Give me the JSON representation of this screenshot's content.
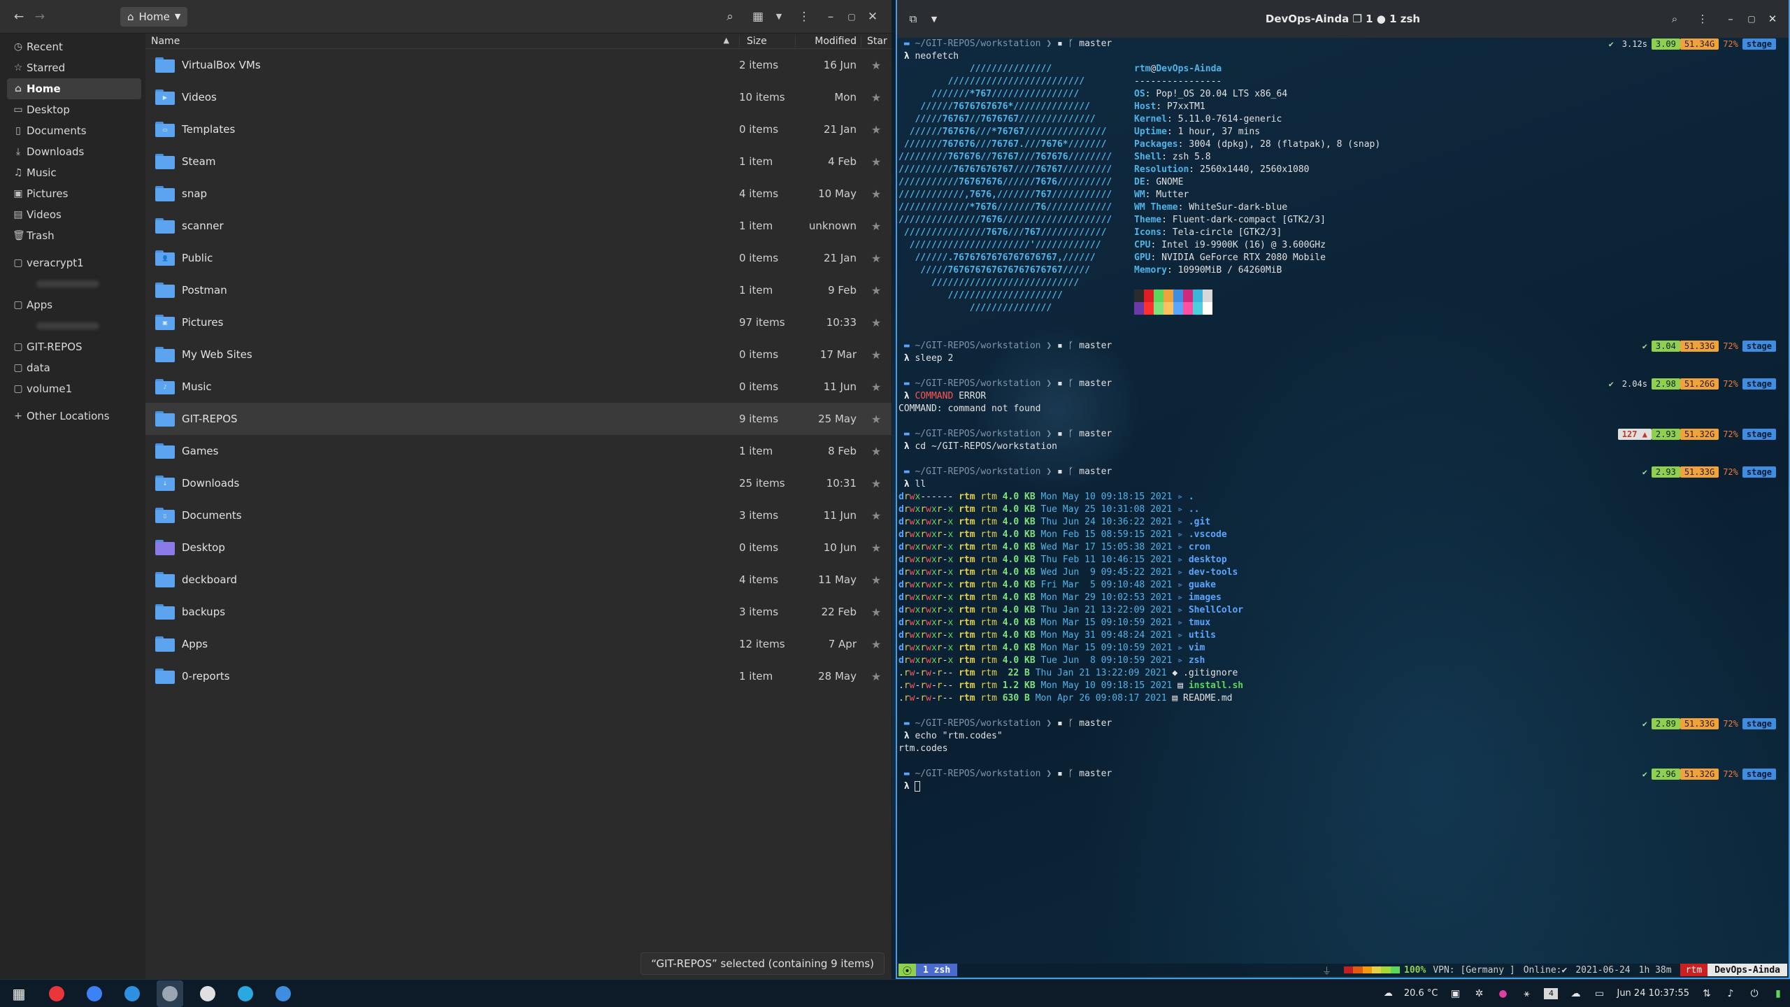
{
  "file_manager": {
    "location": "Home",
    "columns": {
      "name": "Name",
      "size": "Size",
      "modified": "Modified",
      "star": "Star"
    },
    "sidebar": [
      {
        "label": "Recent",
        "icon": "clock-icon",
        "glyph": "◷"
      },
      {
        "label": "Starred",
        "icon": "star-icon",
        "glyph": "☆"
      },
      {
        "label": "Home",
        "icon": "home-icon",
        "glyph": "⌂",
        "active": true
      },
      {
        "label": "Desktop",
        "icon": "desktop-icon",
        "glyph": "▭"
      },
      {
        "label": "Documents",
        "icon": "document-icon",
        "glyph": "▯"
      },
      {
        "label": "Downloads",
        "icon": "download-icon",
        "glyph": "⤓"
      },
      {
        "label": "Music",
        "icon": "music-icon",
        "glyph": "♫"
      },
      {
        "label": "Pictures",
        "icon": "picture-icon",
        "glyph": "▣"
      },
      {
        "label": "Videos",
        "icon": "video-icon",
        "glyph": "▤"
      },
      {
        "label": "Trash",
        "icon": "trash-icon",
        "glyph": "🗑"
      },
      {
        "separator": true
      },
      {
        "label": "veracrypt1",
        "icon": "drive-icon",
        "glyph": "▢"
      },
      {
        "blurred": true
      },
      {
        "label": "Apps",
        "icon": "drive-icon",
        "glyph": "▢"
      },
      {
        "blurred": true
      },
      {
        "label": "GIT-REPOS",
        "icon": "drive-icon",
        "glyph": "▢"
      },
      {
        "label": "data",
        "icon": "drive-icon",
        "glyph": "▢"
      },
      {
        "label": "volume1",
        "icon": "drive-icon",
        "glyph": "▢"
      },
      {
        "separator": true
      },
      {
        "label": "Other Locations",
        "icon": "plus-icon",
        "glyph": "+"
      }
    ],
    "files": [
      {
        "name": "VirtualBox VMs",
        "size": "2 items",
        "modified": "16 Jun"
      },
      {
        "name": "Videos",
        "size": "10 items",
        "modified": "Mon",
        "emblem": "▶"
      },
      {
        "name": "Templates",
        "size": "0 items",
        "modified": "21 Jan",
        "emblem": "▭"
      },
      {
        "name": "Steam",
        "size": "1 item",
        "modified": "4 Feb"
      },
      {
        "name": "snap",
        "size": "4 items",
        "modified": "10 May"
      },
      {
        "name": "scanner",
        "size": "1 item",
        "modified": "unknown"
      },
      {
        "name": "Public",
        "size": "0 items",
        "modified": "21 Jan",
        "emblem": "👤"
      },
      {
        "name": "Postman",
        "size": "1 item",
        "modified": "9 Feb"
      },
      {
        "name": "Pictures",
        "size": "97 items",
        "modified": "10:33",
        "emblem": "▣"
      },
      {
        "name": "My Web Sites",
        "size": "0 items",
        "modified": "17 Mar"
      },
      {
        "name": "Music",
        "size": "0 items",
        "modified": "11 Jun",
        "emblem": "♪"
      },
      {
        "name": "GIT-REPOS",
        "size": "9 items",
        "modified": "25 May",
        "selected": true
      },
      {
        "name": "Games",
        "size": "1 item",
        "modified": "8 Feb"
      },
      {
        "name": "Downloads",
        "size": "25 items",
        "modified": "10:31",
        "emblem": "↓"
      },
      {
        "name": "Documents",
        "size": "3 items",
        "modified": "11 Jun",
        "emblem": "▯"
      },
      {
        "name": "Desktop",
        "size": "0 items",
        "modified": "10 Jun",
        "desktop": true
      },
      {
        "name": "deckboard",
        "size": "4 items",
        "modified": "11 May"
      },
      {
        "name": "backups",
        "size": "3 items",
        "modified": "22 Feb"
      },
      {
        "name": "Apps",
        "size": "12 items",
        "modified": "7 Apr"
      },
      {
        "name": "0-reports",
        "size": "1 item",
        "modified": "28 May"
      }
    ],
    "status": "“GIT-REPOS” selected (containing 9 items)"
  },
  "terminal": {
    "title": "DevOps-Ainda ❐ 1 ● 1 zsh",
    "prompt_path": "~/GIT-REPOS/workstation",
    "branch": "master",
    "neofetch": {
      "command": "neofetch",
      "user": "rtm",
      "host": "DevOps-Ainda",
      "divider": "----------------",
      "info": [
        {
          "k": "OS",
          "v": "Pop!_OS 20.04 LTS x86_64"
        },
        {
          "k": "Host",
          "v": "P7xxTM1"
        },
        {
          "k": "Kernel",
          "v": "5.11.0-7614-generic"
        },
        {
          "k": "Uptime",
          "v": "1 hour, 37 mins"
        },
        {
          "k": "Packages",
          "v": "3004 (dpkg), 28 (flatpak), 8 (snap)"
        },
        {
          "k": "Shell",
          "v": "zsh 5.8"
        },
        {
          "k": "Resolution",
          "v": "2560x1440, 2560x1080"
        },
        {
          "k": "DE",
          "v": "GNOME"
        },
        {
          "k": "WM",
          "v": "Mutter"
        },
        {
          "k": "WM Theme",
          "v": "WhiteSur-dark-blue"
        },
        {
          "k": "Theme",
          "v": "Fluent-dark-compact [GTK2/3]"
        },
        {
          "k": "Icons",
          "v": "Tela-circle [GTK2/3]"
        },
        {
          "k": "CPU",
          "v": "Intel i9-9900K (16) @ 3.600GHz"
        },
        {
          "k": "GPU",
          "v": "NVIDIA GeForce RTX 2080 Mobile"
        },
        {
          "k": "Memory",
          "v": "10990MiB / 64260MiB"
        }
      ],
      "logo": [
        "             ///////////////",
        "         /////////////////////////",
        "      ///////*767////////////////",
        "    //////7676767676*//////////////",
        "   /////76767//7676767//////////////",
        "  //////767676///*76767///////////////",
        " ///////767676///76767.///7676*///////",
        "/////////767676//76767///767676////////",
        "//////////76767676767////76767/////////",
        "///////////76767676//////7676//////////",
        "////////////,7676,///////767///////////",
        "/////////////*7676///////76////////////",
        "///////////////7676////////////////////",
        " ///////////////7676///767////////////",
        "  //////////////////////'////////////",
        "   //////.7676767676767676767,//////",
        "    /////767676767676767676767/////",
        "      ///////////////////////////",
        "         /////////////////////",
        "             ///////////////"
      ],
      "palette": [
        "#2b2b2b",
        "#e01b24",
        "#5bd75b",
        "#f0a33a",
        "#3e8de0",
        "#d0287a",
        "#3cb6d8",
        "#d8d8d8",
        "#6a3aa8",
        "#ff3030",
        "#7ee37e",
        "#ffc060",
        "#5aa6ff",
        "#ff4fa0",
        "#4cd0e0",
        "#ffffff"
      ]
    },
    "blocks": [
      {
        "cmd": "sleep 2",
        "rp": {
          "ok": "✔",
          "load": "3.04",
          "mem": "51.33G",
          "bat": "72%",
          "ctx": "stage"
        }
      },
      {
        "cmd_err": "COMMAND",
        "cmd_rest": " ERROR",
        "output": [
          "COMMAND: command not found"
        ],
        "rp": {
          "ok": "✔",
          "time": "2.04s",
          "load": "2.98",
          "mem": "51.26G",
          "bat": "72%",
          "ctx": "stage"
        }
      },
      {
        "cmd": "cd ~/GIT-REPOS/workstation",
        "rp": {
          "err": "127 ▲",
          "load": "2.93",
          "mem": "51.32G",
          "bat": "72%",
          "ctx": "stage"
        }
      }
    ],
    "first_rp": {
      "ok": "✔",
      "time": "3.12s",
      "load": "3.09",
      "mem": "51.34G",
      "bat": "72%",
      "ctx": "stage"
    },
    "ll": {
      "cmd": "ll",
      "rp": {
        "ok": "✔",
        "load": "2.93",
        "mem": "51.33G",
        "bat": "72%",
        "ctx": "stage"
      },
      "rows": [
        {
          "perm": "drwx------",
          "u": "rtm",
          "g": "rtm",
          "sz": "4.0 KB",
          "date": "Mon May 10 09:18:15 2021",
          "icon": "▹",
          "name": "."
        },
        {
          "perm": "drwxrwxr-x",
          "u": "rtm",
          "g": "rtm",
          "sz": "4.0 KB",
          "date": "Tue May 25 10:31:08 2021",
          "icon": "▹",
          "name": ".."
        },
        {
          "perm": "drwxrwxr-x",
          "u": "rtm",
          "g": "rtm",
          "sz": "4.0 KB",
          "date": "Thu Jun 24 10:36:22 2021",
          "icon": "▹",
          "name": ".git"
        },
        {
          "perm": "drwxrwxr-x",
          "u": "rtm",
          "g": "rtm",
          "sz": "4.0 KB",
          "date": "Mon Feb 15 08:59:15 2021",
          "icon": "▹",
          "name": ".vscode"
        },
        {
          "perm": "drwxrwxr-x",
          "u": "rtm",
          "g": "rtm",
          "sz": "4.0 KB",
          "date": "Wed Mar 17 15:05:38 2021",
          "icon": "▹",
          "name": "cron"
        },
        {
          "perm": "drwxrwxr-x",
          "u": "rtm",
          "g": "rtm",
          "sz": "4.0 KB",
          "date": "Thu Feb 11 10:46:15 2021",
          "icon": "▹",
          "name": "desktop"
        },
        {
          "perm": "drwxrwxr-x",
          "u": "rtm",
          "g": "rtm",
          "sz": "4.0 KB",
          "date": "Wed Jun  9 09:45:22 2021",
          "icon": "▹",
          "name": "dev-tools"
        },
        {
          "perm": "drwxrwxr-x",
          "u": "rtm",
          "g": "rtm",
          "sz": "4.0 KB",
          "date": "Fri Mar  5 09:10:48 2021",
          "icon": "▹",
          "name": "guake"
        },
        {
          "perm": "drwxrwxr-x",
          "u": "rtm",
          "g": "rtm",
          "sz": "4.0 KB",
          "date": "Mon Mar 29 10:02:53 2021",
          "icon": "▹",
          "name": "images"
        },
        {
          "perm": "drwxrwxr-x",
          "u": "rtm",
          "g": "rtm",
          "sz": "4.0 KB",
          "date": "Thu Jan 21 13:22:09 2021",
          "icon": "▹",
          "name": "ShellColor"
        },
        {
          "perm": "drwxrwxr-x",
          "u": "rtm",
          "g": "rtm",
          "sz": "4.0 KB",
          "date": "Mon Mar 15 09:10:59 2021",
          "icon": "▹",
          "name": "tmux"
        },
        {
          "perm": "drwxrwxr-x",
          "u": "rtm",
          "g": "rtm",
          "sz": "4.0 KB",
          "date": "Mon May 31 09:48:24 2021",
          "icon": "▹",
          "name": "utils"
        },
        {
          "perm": "drwxrwxr-x",
          "u": "rtm",
          "g": "rtm",
          "sz": "4.0 KB",
          "date": "Mon Mar 15 09:10:59 2021",
          "icon": "▹",
          "name": "vim"
        },
        {
          "perm": "drwxrwxr-x",
          "u": "rtm",
          "g": "rtm",
          "sz": "4.0 KB",
          "date": "Tue Jun  8 09:10:59 2021",
          "icon": "▹",
          "name": "zsh"
        },
        {
          "perm": ".rw-rw-r--",
          "u": "rtm",
          "g": "rtm",
          "sz": " 22 B",
          "date": "Thu Jan 21 13:22:09 2021",
          "icon": "◆",
          "name": ".gitignore",
          "file": true
        },
        {
          "perm": ".rw-rw-r--",
          "u": "rtm",
          "g": "rtm",
          "sz": "1.2 KB",
          "date": "Mon May 10 09:18:15 2021",
          "icon": "▤",
          "name": "install.sh",
          "file": true,
          "exec": true
        },
        {
          "perm": ".rw-rw-r--",
          "u": "rtm",
          "g": "rtm",
          "sz": "630 B",
          "date": "Mon Apr 26 09:08:17 2021",
          "icon": "▤",
          "name": "README.md",
          "file": true
        }
      ]
    },
    "echo": {
      "cmd": "echo \"rtm.codes\"",
      "output": "rtm.codes",
      "rp": {
        "ok": "✔",
        "load": "2.89",
        "mem": "51.33G",
        "bat": "72%",
        "ctx": "stage"
      }
    },
    "last_rp": {
      "ok": "✔",
      "load": "2.96",
      "mem": "51.32G",
      "bat": "72%",
      "ctx": "stage"
    },
    "tmux": {
      "session_icon": "⦿",
      "window": "1 zsh",
      "battery_pct": "100%",
      "vpn": "VPN: [Germany ]",
      "online": "Online:✔",
      "date": "2021-06-24",
      "uptime": "1h 38m",
      "user": "rtm",
      "host": "DevOps-Ainda"
    }
  },
  "taskbar": {
    "apps": [
      {
        "name": "app-launcher-icon",
        "color": "#ffffff",
        "glyph": "▦"
      },
      {
        "name": "vivaldi-icon",
        "color": "#e8363b"
      },
      {
        "name": "chrome-icon",
        "color": "#3b82f6"
      },
      {
        "name": "vscode-icon",
        "color": "#2f8fe0"
      },
      {
        "name": "files-icon",
        "color": "#9aa6b2",
        "active": true
      },
      {
        "name": "slack-icon",
        "color": "#e0e0e0"
      },
      {
        "name": "skype-icon",
        "color": "#2aa8e0"
      },
      {
        "name": "terminal-icon",
        "color": "#3e8de0"
      }
    ],
    "weather": "20.6 °C",
    "workspace": "4",
    "clock": "Jun 24  10:37:55"
  },
  "colors": {
    "accent": "#4a9be0",
    "folder": "#5ca4ef"
  }
}
